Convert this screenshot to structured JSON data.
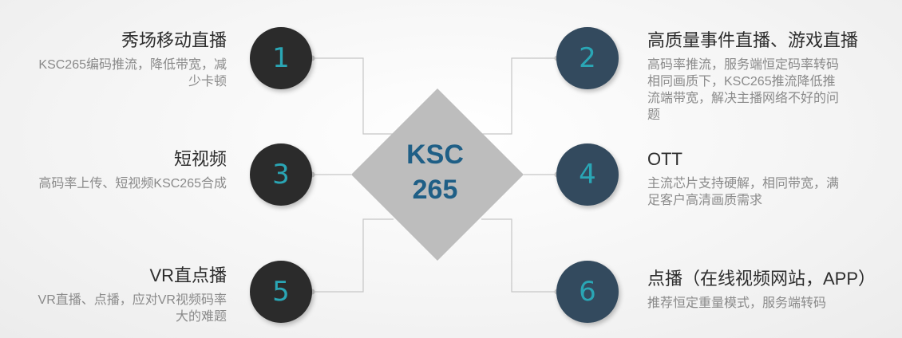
{
  "center": {
    "line1": "KSC",
    "line2": "265"
  },
  "items": [
    {
      "number": "1",
      "title": "秀场移动直播",
      "desc": [
        "KSC265编码推流，降低带宽，减",
        "少卡顿"
      ]
    },
    {
      "number": "2",
      "title": "高质量事件直播、游戏直播",
      "desc": [
        "高码率推流，服务端恒定码率转码",
        "相同画质下，KSC265推流降低推",
        "流端带宽，解决主播网络不好的问",
        "题"
      ]
    },
    {
      "number": "3",
      "title": "短视频",
      "desc": [
        "高码率上传、短视频KSC265合成"
      ]
    },
    {
      "number": "4",
      "title": "OTT",
      "desc": [
        "主流芯片支持硬解，相同带宽，满",
        "足客户高清画质需求"
      ]
    },
    {
      "number": "5",
      "title": "VR直点播",
      "desc": [
        "VR直播、点播，应对VR视频码率",
        "大的难题"
      ]
    },
    {
      "number": "6",
      "title": "点播（在线视频网站，APP）",
      "desc": [
        "推荐恒定重量模式，服务端转码"
      ]
    }
  ],
  "colors": {
    "diamond": "#bdbdbd",
    "circle_dark": "#2b2b2b",
    "circle_navy": "#334a5e",
    "number": "#2aa6b5",
    "center_text": "#1f5f86",
    "connector": "#c4c4c4"
  }
}
